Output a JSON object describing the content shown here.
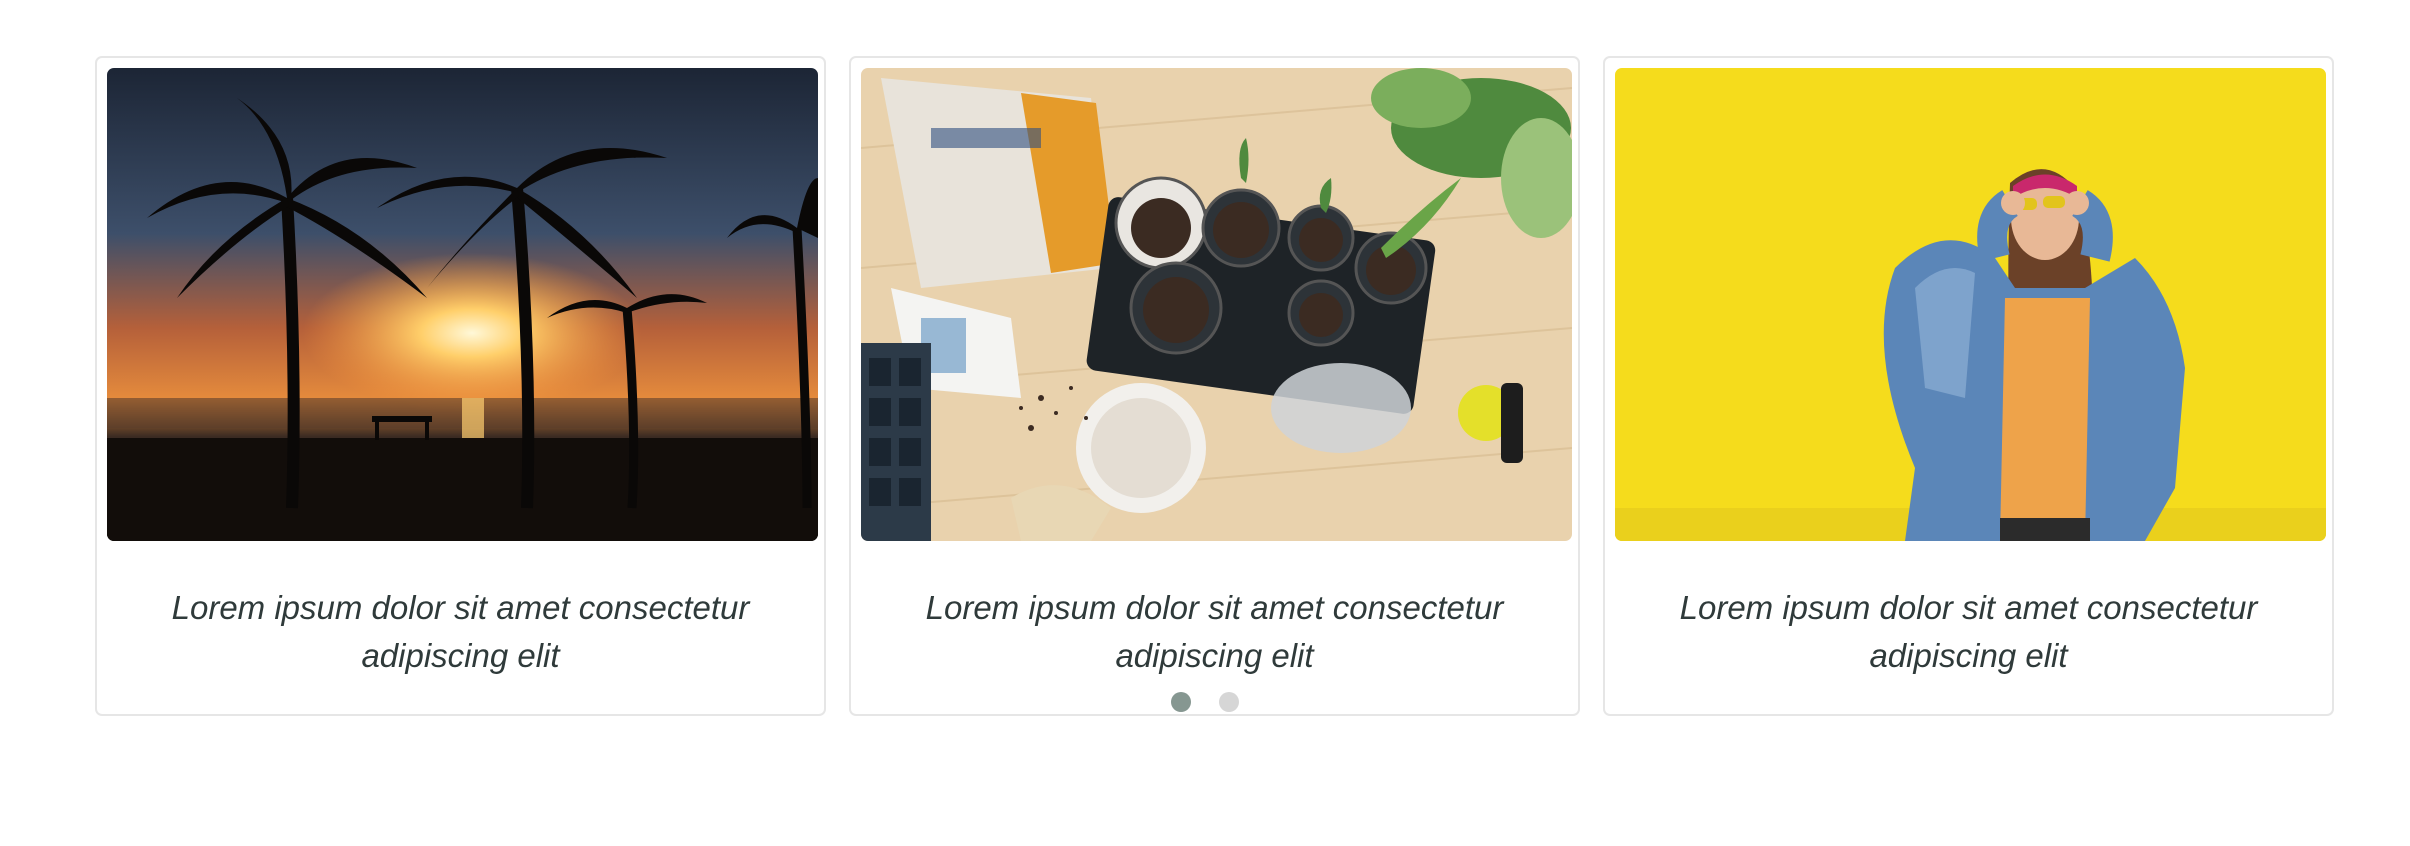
{
  "cards": [
    {
      "image_name": "sunset-palm-trees-image",
      "caption": "Lorem ipsum dolor sit amet consectetur adipiscing elit"
    },
    {
      "image_name": "gardening-plants-image",
      "caption": "Lorem ipsum dolor sit amet consectetur adipiscing elit"
    },
    {
      "image_name": "woman-yellow-wall-image",
      "caption": "Lorem ipsum dolor sit amet consectetur adipiscing elit"
    }
  ],
  "pagination": {
    "total_pages": 2,
    "active_page": 1
  },
  "colors": {
    "dot_active": "#869791",
    "dot_inactive": "#d6d6d6",
    "caption_text": "#2f3a3a",
    "card_border": "#e6e6e6"
  }
}
